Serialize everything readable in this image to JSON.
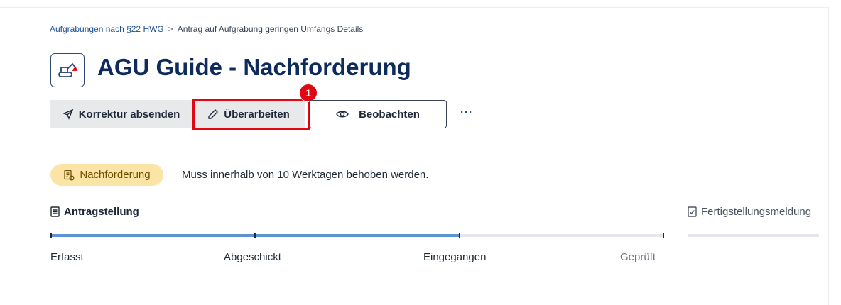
{
  "breadcrumb": {
    "link": "Aufgrabungen nach §22 HWG",
    "separator": ">",
    "current": "Antrag auf Aufgrabung geringen Umfangs Details"
  },
  "title": {
    "text": "AGU Guide - Nachforderung",
    "icon": "excavator-icon"
  },
  "actions": {
    "korrektur_label": "Korrektur absenden",
    "ueberarbeiten_label": "Überarbeiten",
    "beobachten_label": "Beobachten",
    "more_label": "···",
    "step_marker": "1"
  },
  "status": {
    "badge_label": "Nachforderung",
    "message": "Muss innerhalb von 10 Werktagen behoben werden."
  },
  "progress": {
    "section_label": "Antragstellung",
    "next_section_label": "Fertigstellungsmeldung",
    "completed_fraction": 0.667,
    "steps": [
      {
        "label": "Erfasst",
        "state": "done"
      },
      {
        "label": "Abgeschickt",
        "state": "done"
      },
      {
        "label": "Eingegangen",
        "state": "current"
      },
      {
        "label": "Geprüft",
        "state": "pending"
      }
    ]
  },
  "colors": {
    "title": "#0d2b5c",
    "highlight": "#e20613",
    "progress_fill": "#5b94cf",
    "badge_bg": "#fbe4a6"
  }
}
